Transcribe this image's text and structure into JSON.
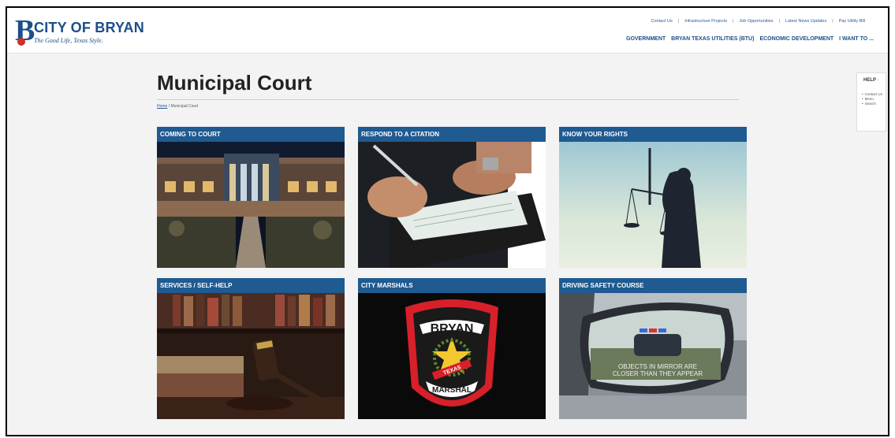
{
  "header": {
    "logo_name": "CITY OF BRYAN",
    "logo_tagline": "The Good Life, Texas Style.",
    "utility_links": [
      "Contact Us",
      "Infrastructure Projects",
      "Job Opportunities",
      "Latest News Updates",
      "Pay Utility Bill"
    ],
    "main_nav": [
      "GOVERNMENT",
      "BRYAN TEXAS UTILITIES (BTU)",
      "ECONOMIC DEVELOPMENT",
      "I WANT TO ..."
    ]
  },
  "page": {
    "title": "Municipal Court",
    "breadcrumb_home": "Home",
    "breadcrumb_sep": " / ",
    "breadcrumb_current": "Municipal Court"
  },
  "tiles": [
    {
      "label": "COMING TO COURT",
      "image": "courthouse-night"
    },
    {
      "label": "RESPOND TO A CITATION",
      "image": "writing-citation"
    },
    {
      "label": "KNOW YOUR RIGHTS",
      "image": "lady-justice"
    },
    {
      "label": "SERVICES / SELF-HELP",
      "image": "gavel-books"
    },
    {
      "label": "CITY MARSHALS",
      "image": "marshal-badge"
    },
    {
      "label": "DRIVING SAFETY COURSE",
      "image": "side-mirror-police"
    }
  ],
  "badge": {
    "top": "BRYAN",
    "middle": "TEXAS",
    "bottom": "MARSHAL"
  },
  "mirror_text": [
    "OBJECTS IN MIRROR ARE",
    "CLOSER THAN THEY APPEAR"
  ],
  "help": {
    "title": "HELP",
    "chevron": "›",
    "items": [
      "Contact Us",
      "Menu",
      "Search"
    ]
  }
}
